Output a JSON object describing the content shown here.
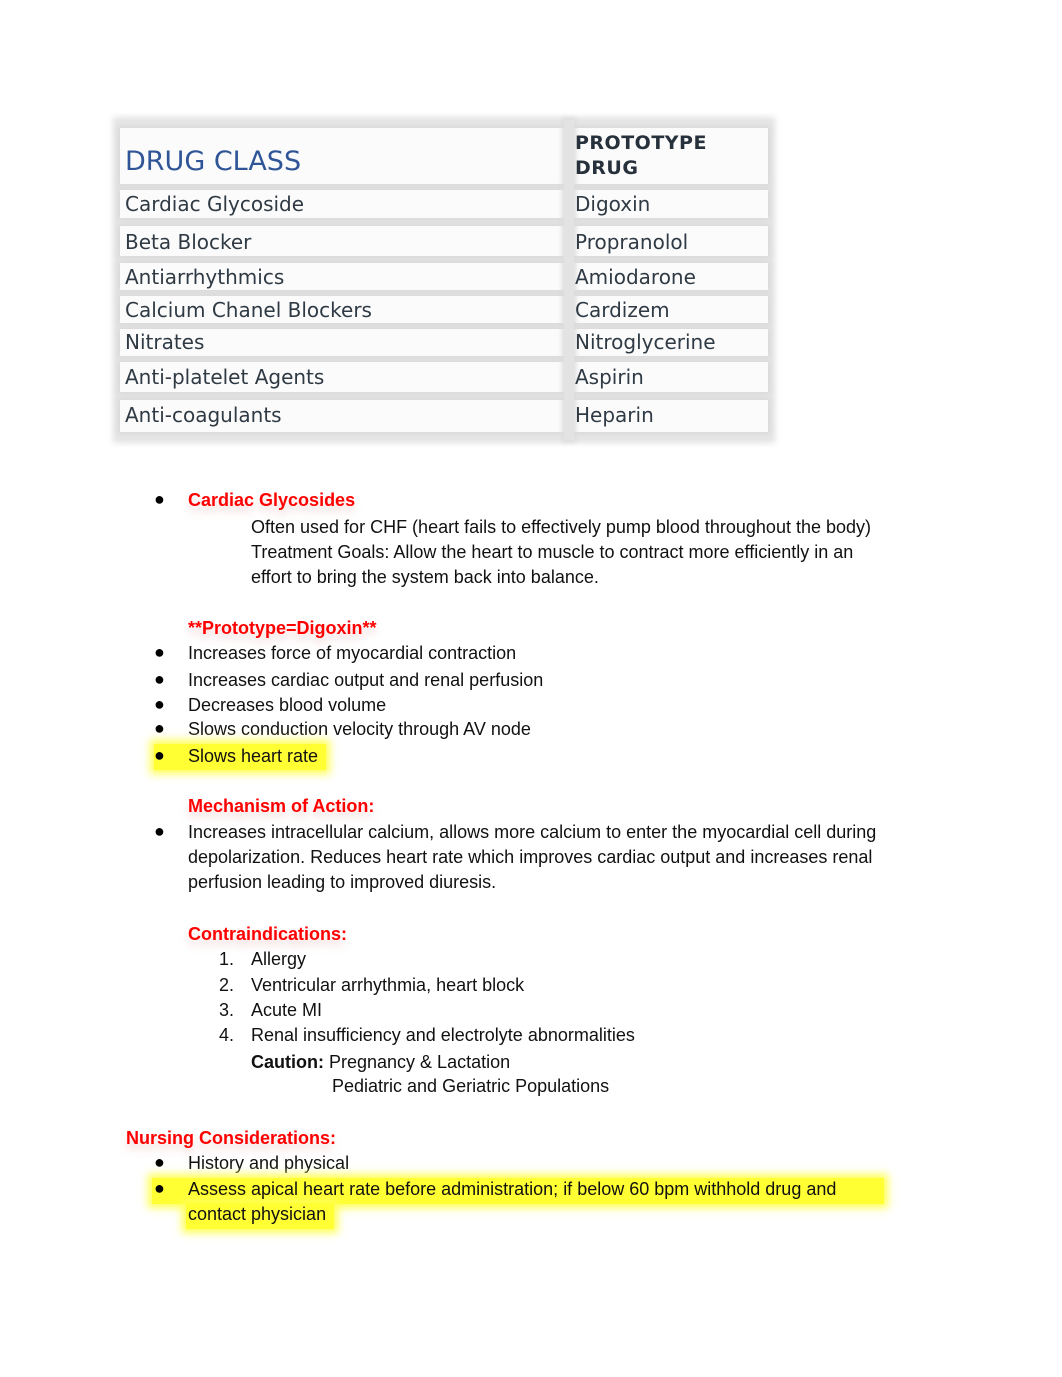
{
  "table": {
    "header": {
      "drug_class": "DRUG CLASS",
      "prototype_line1": "PROTOTYPE",
      "prototype_line2": "DRUG"
    },
    "rows": [
      {
        "drug_class": "Cardiac Glycoside",
        "prototype": "Digoxin"
      },
      {
        "drug_class": "Beta Blocker",
        "prototype": "Propranolol"
      },
      {
        "drug_class": "Antiarrhythmics",
        "prototype": "Amiodarone"
      },
      {
        "drug_class": "Calcium Chanel Blockers",
        "prototype": "Cardizem"
      },
      {
        "drug_class": "Nitrates",
        "prototype": "Nitroglycerine"
      },
      {
        "drug_class": "Anti-platelet Agents",
        "prototype": "Aspirin"
      },
      {
        "drug_class": "Anti-coagulants",
        "prototype": "Heparin"
      }
    ]
  },
  "cardiac_glycosides": {
    "heading": "Cardiac Glycosides",
    "desc_lines": [
      "Often used for CHF (heart fails to effectively pump blood throughout the body)",
      "Treatment Goals: Allow the heart to muscle to contract more efficiently in an",
      "effort to bring the system back into balance."
    ]
  },
  "prototype": {
    "heading": "**Prototype=Digoxin**",
    "effects": [
      "Increases force of myocardial contraction",
      "Increases cardiac output and renal perfusion",
      "Decreases blood volume",
      "Slows conduction velocity through AV node",
      "Slows heart rate"
    ]
  },
  "mechanism": {
    "heading": "Mechanism of Action:",
    "lines": [
      "Increases intracellular calcium, allows more calcium to enter the myocardial cell during",
      "depolarization. Reduces heart rate which improves cardiac output and increases renal",
      "perfusion leading to improved diuresis."
    ]
  },
  "contraindications": {
    "heading": "Contraindications:",
    "items": [
      {
        "num": "1.",
        "text": "Allergy"
      },
      {
        "num": "2.",
        "text": "Ventricular arrhythmia, heart block"
      },
      {
        "num": "3.",
        "text": "Acute MI"
      },
      {
        "num": "4.",
        "text": "Renal insufficiency and electrolyte abnormalities"
      }
    ],
    "caution_label": "Caution:",
    "caution_line1": "Pregnancy & Lactation",
    "caution_line2": "Pediatric and Geriatric Populations"
  },
  "nursing": {
    "heading": "Nursing Considerations:",
    "items": [
      "History and physical",
      "Assess apical heart rate before administration; if below 60 bpm withhold drug and",
      "contact physician"
    ]
  },
  "colors": {
    "heading_red": "#ff0000",
    "table_header_blue": "#2f5597",
    "highlight_yellow": "#ffff33"
  }
}
